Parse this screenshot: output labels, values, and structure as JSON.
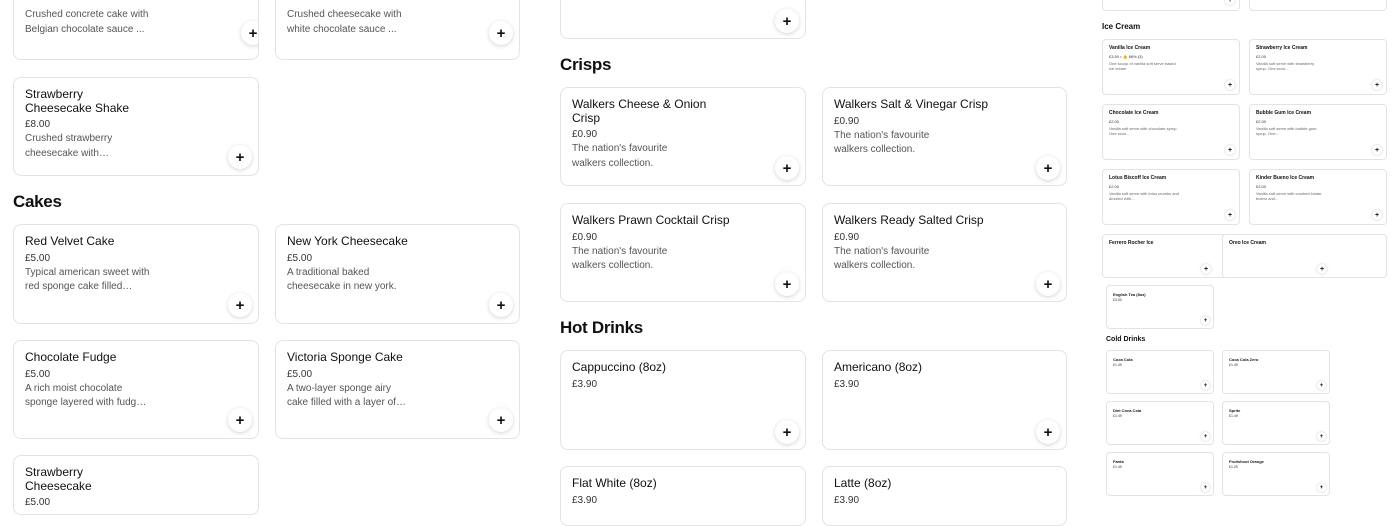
{
  "left": {
    "top_cards": [
      {
        "title": "",
        "price": "",
        "desc": "Crushed concrete cake with Belgian chocolate sauce ..."
      },
      {
        "title": "",
        "price": "",
        "desc": "Crushed cheesecake with white chocolate sauce ..."
      }
    ],
    "shake_card": {
      "title": "Strawberry Cheesecake Shake",
      "price": "£8.00",
      "desc": "Crushed strawberry cheesecake with strawberr..."
    },
    "cakes_heading": "Cakes",
    "cakes": [
      {
        "title": "Red Velvet Cake",
        "price": "£5.00",
        "desc": "Typical american sweet with red sponge cake filled with..."
      },
      {
        "title": "New York Cheesecake",
        "price": "£5.00",
        "desc": "A traditional baked cheesecake in new york."
      },
      {
        "title": "Chocolate Fudge",
        "price": "£5.00",
        "desc": "A rich moist chocolate sponge layered with fudge ..."
      },
      {
        "title": "Victoria Sponge Cake",
        "price": "£5.00",
        "desc": "A two-layer sponge airy cake filled with a layer of jam an..."
      },
      {
        "title": "Strawberry Cheesecake",
        "price": "£5.00",
        "desc": ""
      }
    ]
  },
  "middle": {
    "crisps_heading": "Crisps",
    "crisps": [
      {
        "title": "Walkers Cheese & Onion Crisp",
        "price": "£0.90",
        "desc": "The nation's favourite walkers collection."
      },
      {
        "title": "Walkers Salt & Vinegar Crisp",
        "price": "£0.90",
        "desc": "The nation's favourite walkers collection."
      },
      {
        "title": "Walkers Prawn Cocktail Crisp",
        "price": "£0.90",
        "desc": "The nation's favourite walkers collection."
      },
      {
        "title": "Walkers Ready Salted Crisp",
        "price": "£0.90",
        "desc": "The nation's favourite walkers collection."
      }
    ],
    "hot_heading": "Hot Drinks",
    "hot": [
      {
        "title": "Cappuccino (8oz)",
        "price": "£3.90"
      },
      {
        "title": "Americano (8oz)",
        "price": "£3.90"
      },
      {
        "title": "Flat White (8oz)",
        "price": "£3.90"
      },
      {
        "title": "Latte (8oz)",
        "price": "£3.90"
      }
    ]
  },
  "right": {
    "ice_heading": "Ice Cream",
    "ice": [
      {
        "title": "Vanilla Ice Cream",
        "price": "£3.50 • 👍 66% (3)",
        "desc": "One scoop of vanilla soft serve based ice cream"
      },
      {
        "title": "Strawberry Ice Cream",
        "price": "£2.00",
        "desc": "Vanilla soft serve with strawberry syrup. One scoo..."
      },
      {
        "title": "Chocolate Ice Cream",
        "price": "£2.00",
        "desc": "Vanilla soft serve with chocolate syrup. One scoo..."
      },
      {
        "title": "Bubble Gum Ice Cream",
        "price": "£2.00",
        "desc": "Vanilla soft serve with bubble gum syrup. One..."
      },
      {
        "title": "Lotus Biscoff Ice Cream",
        "price": "£2.00",
        "desc": "Vanilla soft serve with lotus crumbs and drizzled with..."
      },
      {
        "title": "Kinder Bueno Ice Cream",
        "price": "£2.00",
        "desc": "Vanilla soft serve with crushed kinder bueno and..."
      },
      {
        "title": "Ferrero Rocher Ice",
        "price": "",
        "desc": ""
      },
      {
        "title": "Oreo Ice Cream",
        "price": "",
        "desc": ""
      }
    ],
    "tea": {
      "title": "English Tea (8oz)",
      "price": "£3.00"
    },
    "cold_heading": "Cold Drinks",
    "cold": [
      {
        "title": "Coca Cola",
        "price": "£1.49"
      },
      {
        "title": "Coca Cola Zero",
        "price": "£1.49"
      },
      {
        "title": "Diet Coca Cola",
        "price": "£1.49"
      },
      {
        "title": "Sprite",
        "price": "£1.49"
      },
      {
        "title": "Fanta",
        "price": "£1.49"
      },
      {
        "title": "Fruitshoot Orange",
        "price": "£1.25"
      }
    ]
  },
  "add_symbol": "+",
  "icons": {
    "add": "plus-icon"
  }
}
